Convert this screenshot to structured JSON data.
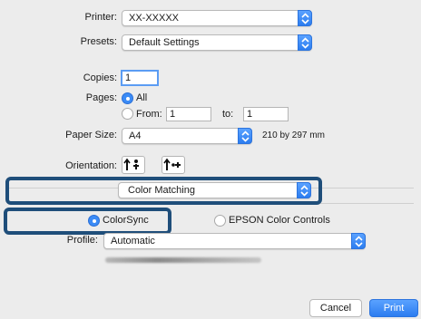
{
  "printer": {
    "label": "Printer:",
    "value": "XX-XXXXX"
  },
  "presets": {
    "label": "Presets:",
    "value": "Default Settings"
  },
  "copies": {
    "label": "Copies:",
    "value": "1"
  },
  "pages": {
    "label": "Pages:",
    "all_label": "All",
    "from_label": "From:",
    "from_value": "1",
    "to_label": "to:",
    "to_value": "1"
  },
  "paper_size": {
    "label": "Paper Size:",
    "value": "A4",
    "dimensions": "210 by 297 mm"
  },
  "orientation": {
    "label": "Orientation:"
  },
  "panel_menu": {
    "value": "Color Matching"
  },
  "color_matching": {
    "colorsync_label": "ColorSync",
    "epson_label": "EPSON Color Controls",
    "profile_label": "Profile:",
    "profile_value": "Automatic"
  },
  "buttons": {
    "cancel": "Cancel",
    "print": "Print"
  },
  "colors": {
    "accent": "#3b8bf6",
    "callout": "#1f4e7a",
    "background": "#ececec"
  }
}
